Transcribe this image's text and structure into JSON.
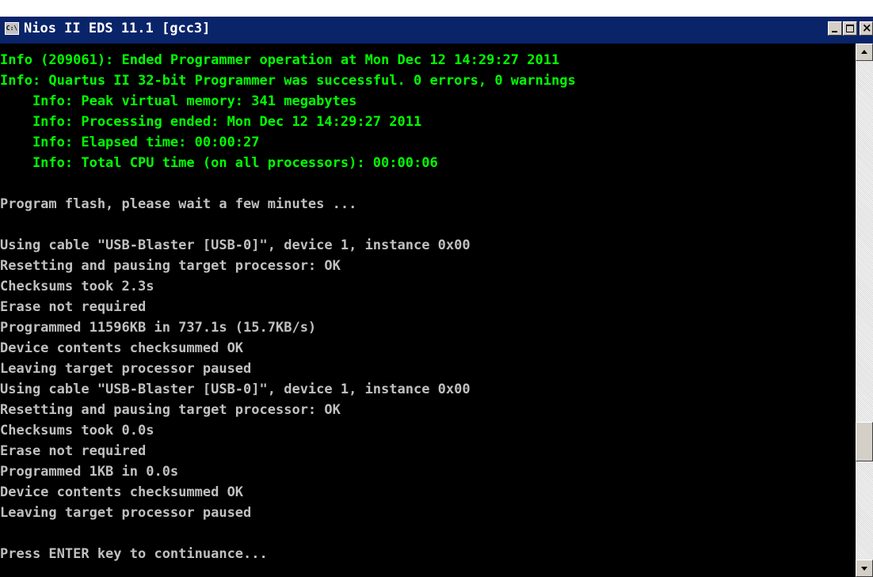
{
  "window": {
    "title": "Nios II EDS 11.1 [gcc3]",
    "system_icon_label": "C:\\",
    "close_label": "×"
  },
  "console": {
    "lines": [
      {
        "text": "Info (209061): Ended Programmer operation at Mon Dec 12 14:29:27 2011",
        "color": "green"
      },
      {
        "text": "Info: Quartus II 32-bit Programmer was successful. 0 errors, 0 warnings",
        "color": "green"
      },
      {
        "text": "    Info: Peak virtual memory: 341 megabytes",
        "color": "green"
      },
      {
        "text": "    Info: Processing ended: Mon Dec 12 14:29:27 2011",
        "color": "green"
      },
      {
        "text": "    Info: Elapsed time: 00:00:27",
        "color": "green"
      },
      {
        "text": "    Info: Total CPU time (on all processors): 00:00:06",
        "color": "green"
      },
      {
        "text": "",
        "color": "white"
      },
      {
        "text": "Program flash, please wait a few minutes ...",
        "color": "white"
      },
      {
        "text": "",
        "color": "white"
      },
      {
        "text": "Using cable \"USB-Blaster [USB-0]\", device 1, instance 0x00",
        "color": "white"
      },
      {
        "text": "Resetting and pausing target processor: OK",
        "color": "white"
      },
      {
        "text": "Checksums took 2.3s",
        "color": "white"
      },
      {
        "text": "Erase not required",
        "color": "white"
      },
      {
        "text": "Programmed 11596KB in 737.1s (15.7KB/s)",
        "color": "white"
      },
      {
        "text": "Device contents checksummed OK",
        "color": "white"
      },
      {
        "text": "Leaving target processor paused",
        "color": "white"
      },
      {
        "text": "Using cable \"USB-Blaster [USB-0]\", device 1, instance 0x00",
        "color": "white"
      },
      {
        "text": "Resetting and pausing target processor: OK",
        "color": "white"
      },
      {
        "text": "Checksums took 0.0s",
        "color": "white"
      },
      {
        "text": "Erase not required",
        "color": "white"
      },
      {
        "text": "Programmed 1KB in 0.0s",
        "color": "white"
      },
      {
        "text": "Device contents checksummed OK",
        "color": "white"
      },
      {
        "text": "Leaving target processor paused",
        "color": "white"
      },
      {
        "text": "",
        "color": "white"
      },
      {
        "text": "Press ENTER key to continuance...",
        "color": "white"
      }
    ]
  },
  "colors": {
    "titlebar": "#0a246a",
    "console_bg": "#000000",
    "green_text": "#00ff00",
    "white_text": "#c0c0c0"
  }
}
